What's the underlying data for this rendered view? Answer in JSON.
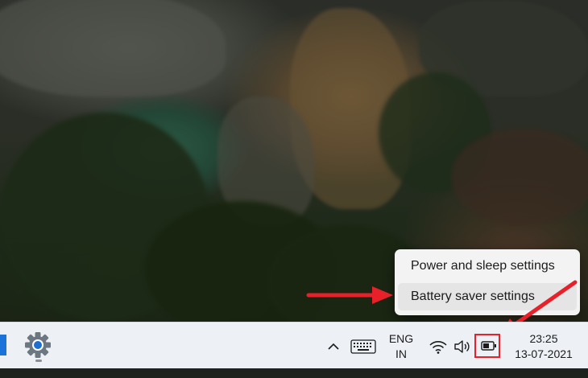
{
  "context_menu": {
    "items": [
      {
        "label": "Power and sleep settings"
      },
      {
        "label": "Battery saver settings"
      }
    ]
  },
  "taskbar": {
    "pinned_apps": [
      "settings-gear-icon"
    ],
    "tray": {
      "overflow_icon": "chevron-up-icon",
      "keyboard_icon": "keyboard-icon",
      "language": {
        "line1": "ENG",
        "line2": "IN"
      },
      "wifi_icon": "wifi-icon",
      "volume_icon": "speaker-icon",
      "battery_icon": "battery-icon"
    },
    "clock": {
      "time": "23:25",
      "date": "13-07-2021"
    }
  },
  "colors": {
    "annotation_red": "#e8202a",
    "taskbar_bg": "#edf1f6",
    "menu_bg": "#f3f3f3",
    "start_blue": "#1a73d8"
  }
}
